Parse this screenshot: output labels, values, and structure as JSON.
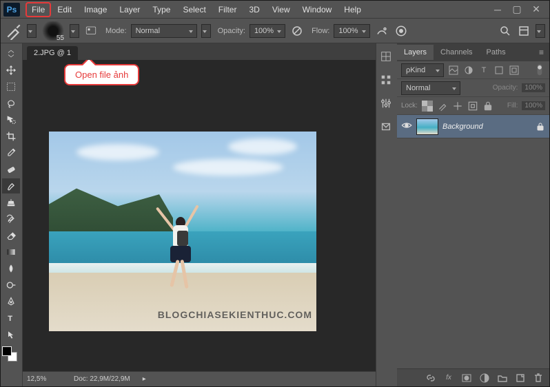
{
  "app_logo_text": "Ps",
  "menu": [
    "File",
    "Edit",
    "Image",
    "Layer",
    "Type",
    "Select",
    "Filter",
    "3D",
    "View",
    "Window",
    "Help"
  ],
  "highlighted_menu_index": 0,
  "callout_text": "Open file ảnh",
  "options_bar": {
    "brush_size": "55",
    "mode_label": "Mode:",
    "mode_value": "Normal",
    "opacity_label": "Opacity:",
    "opacity_value": "100%",
    "flow_label": "Flow:",
    "flow_value": "100%"
  },
  "document": {
    "tab_title": "2.JPG @ 1",
    "zoom": "12,5%",
    "doc_info_label": "Doc:",
    "doc_info": "22,9M/22,9M"
  },
  "watermark": "BLOGCHIASEKIENTHUC.COM",
  "panels": {
    "tabs": [
      "Layers",
      "Channels",
      "Paths"
    ],
    "active_tab": 0,
    "kind_label": "Kind",
    "blend_mode": "Normal",
    "opacity_label": "Opacity:",
    "opacity_value": "100%",
    "lock_label": "Lock:",
    "fill_label": "Fill:",
    "fill_value": "100%",
    "layers": [
      {
        "name": "Background",
        "visible": true,
        "locked": true,
        "selected": true
      }
    ]
  },
  "tool_names": [
    "move-tool",
    "marquee-tool",
    "lasso-tool",
    "quick-select-tool",
    "crop-tool",
    "eyedropper-tool",
    "healing-tool",
    "brush-tool",
    "clone-stamp-tool",
    "history-brush-tool",
    "eraser-tool",
    "gradient-tool",
    "blur-tool",
    "dodge-tool",
    "pen-tool",
    "type-tool",
    "path-select-tool"
  ],
  "selected_tool_index": 7,
  "footer_icon_names": [
    "link-icon",
    "fx-icon",
    "mask-icon",
    "adjustment-icon",
    "group-icon",
    "new-layer-icon",
    "trash-icon"
  ],
  "dock_icon_names": [
    "color-panel-icon",
    "swatches-panel-icon",
    "adjustments-panel-icon",
    "styles-panel-icon"
  ]
}
